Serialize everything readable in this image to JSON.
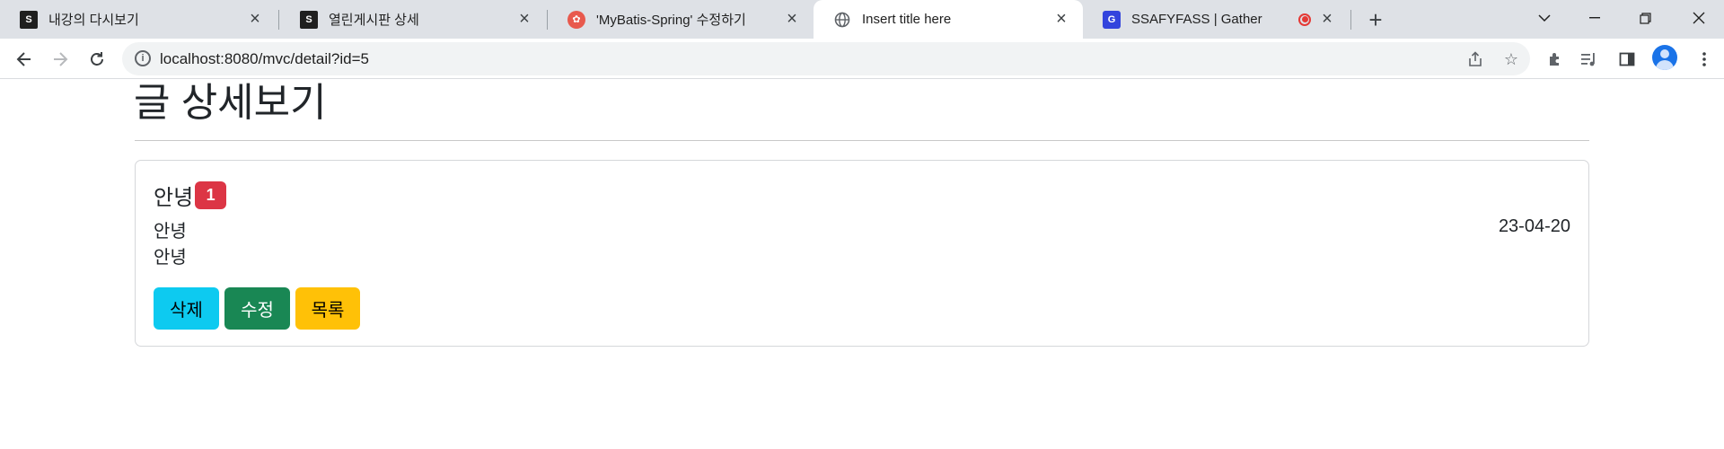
{
  "tabs": [
    {
      "title": "내강의 다시보기",
      "favicon": "S"
    },
    {
      "title": "열린게시판 상세",
      "favicon": "S"
    },
    {
      "title": "'MyBatis-Spring' 수정하기",
      "favicon": "✿"
    },
    {
      "title": "Insert title here",
      "favicon": "globe-icon"
    },
    {
      "title": "SSAFYFASS | Gather",
      "favicon": "G"
    }
  ],
  "address_bar": {
    "url": "localhost:8080/mvc/detail?id=5"
  },
  "page": {
    "title": "글 상세보기",
    "post": {
      "title": "안녕",
      "view_count": "1",
      "content_lines": [
        "안녕",
        "안녕"
      ],
      "date": "23-04-20"
    },
    "buttons": {
      "delete": "삭제",
      "edit": "수정",
      "list": "목록"
    }
  },
  "colors": {
    "badge": "#dc3545",
    "btn_info": "#0dcaf0",
    "btn_success": "#198754",
    "btn_warning": "#ffc107"
  }
}
